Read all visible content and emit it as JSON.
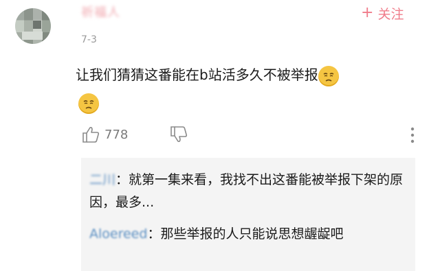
{
  "comment": {
    "author_name": "祈福人",
    "date": "7-3",
    "follow_label": "关注",
    "text": "让我们猜猜这番能在b站活多久不被举报",
    "emoji_icon": "sad-face-emoji",
    "like_count": "778"
  },
  "icons": {
    "like": "thumbs-up-icon",
    "dislike": "thumbs-down-icon",
    "more": "more-vertical-icon",
    "follow": "plus-icon"
  },
  "replies": [
    {
      "author": "二川",
      "text": "：就第一集来看，我找不出这番能被举报下架的原因，最多..."
    },
    {
      "author": "Aloereed",
      "text": "：那些举报的人只能说思想龌龊吧"
    }
  ],
  "colors": {
    "accent": "#f07c8a",
    "link": "#5b8fc2",
    "muted": "#9a9a9a",
    "reply_bg": "#f4f4f4"
  }
}
